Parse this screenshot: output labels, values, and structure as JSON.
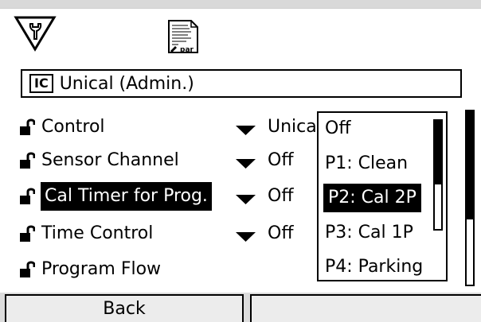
{
  "header": {
    "left_icon": "wrench-in-triangle-icon",
    "doc_icon": "parameter-document-icon",
    "doc_icon_caption": "par"
  },
  "title_bar": {
    "badge": "IC",
    "title": "Unical (Admin.)"
  },
  "rows": [
    {
      "label": "Control",
      "value": "Unical",
      "has_arrow": true,
      "selected": false
    },
    {
      "label": "Sensor Channel",
      "value": "Off",
      "has_arrow": true,
      "selected": false
    },
    {
      "label": "Cal Timer for Prog.",
      "value": "Off",
      "has_arrow": true,
      "selected": true
    },
    {
      "label": "Time Control",
      "value": "Off",
      "has_arrow": true,
      "selected": false
    },
    {
      "label": "Program Flow",
      "value": "",
      "has_arrow": false,
      "selected": false
    }
  ],
  "dropdown": {
    "options": [
      "Off",
      "P1: Clean",
      "P2: Cal 2P",
      "P3: Cal 1P",
      "P4: Parking"
    ],
    "selected_index": 2
  },
  "softkeys": {
    "left": "Back",
    "right": ""
  },
  "icons": {
    "row_icon": "lock-open-icon",
    "row_arrow": "triangle-down-icon"
  }
}
